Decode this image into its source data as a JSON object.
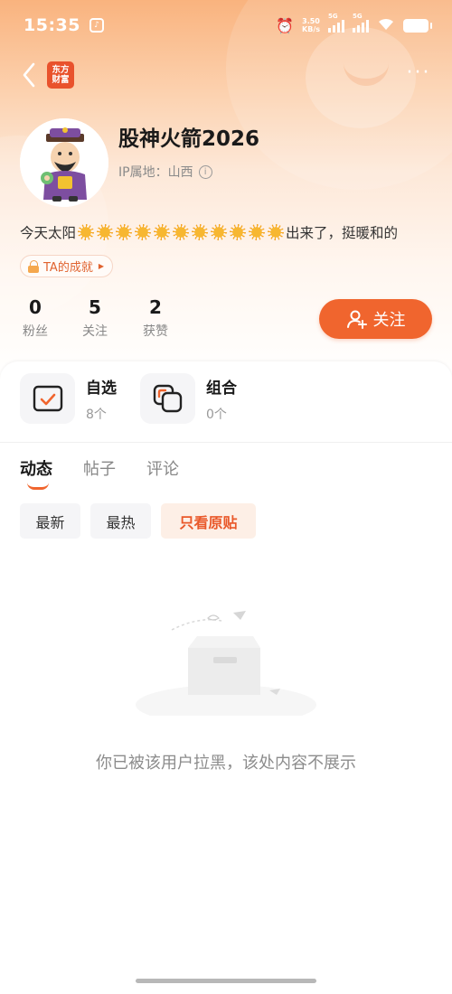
{
  "status_bar": {
    "time": "15:35",
    "speed_value": "3.50",
    "speed_unit": "KB/s",
    "signal1_label": "5G",
    "signal2_label": "5G"
  },
  "nav": {
    "logo_line1": "东方",
    "logo_line2": "财富"
  },
  "profile": {
    "username": "股神火箭2026",
    "ip_location": "IP属地：山西",
    "bio_before": "今天太阳",
    "bio_sun_count": 11,
    "bio_after": "出来了，挺暖和的",
    "achievement_label": "TA的成就"
  },
  "stats": [
    {
      "value": "0",
      "label": "粉丝"
    },
    {
      "value": "5",
      "label": "关注"
    },
    {
      "value": "2",
      "label": "获赞"
    }
  ],
  "follow_button_label": "关注",
  "shortcuts": [
    {
      "title": "自选",
      "count": "8个"
    },
    {
      "title": "组合",
      "count": "0个"
    }
  ],
  "tabs": [
    {
      "label": "动态",
      "active": true
    },
    {
      "label": "帖子",
      "active": false
    },
    {
      "label": "评论",
      "active": false
    }
  ],
  "filters": [
    {
      "label": "最新",
      "active": false
    },
    {
      "label": "最热",
      "active": false
    },
    {
      "label": "只看原贴",
      "active": true
    }
  ],
  "empty_state_text": "你已被该用户拉黑，该处内容不展示",
  "colors": {
    "accent": "#f0652e",
    "header_gradient_top": "#f9b37e"
  }
}
